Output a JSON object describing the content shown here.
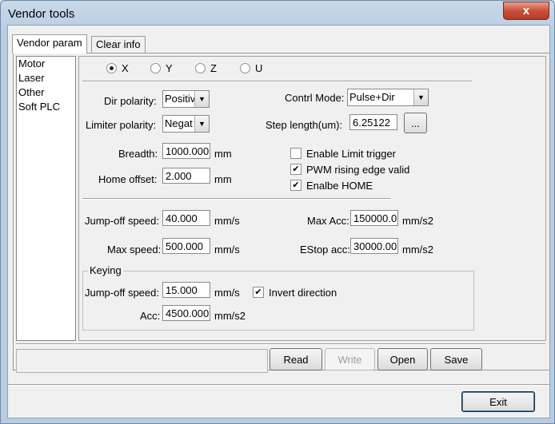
{
  "window": {
    "title": "Vendor tools",
    "close_glyph": "x"
  },
  "tabs": [
    {
      "label": "Vendor param"
    },
    {
      "label": "Clear info"
    }
  ],
  "sidebar": {
    "items": [
      "Motor",
      "Laser",
      "Other",
      "Soft PLC"
    ]
  },
  "axes": {
    "options": [
      "X",
      "Y",
      "Z",
      "U"
    ],
    "selected": "X"
  },
  "motor": {
    "dir_polarity_label": "Dir polarity:",
    "dir_polarity_value": "Positiv",
    "limiter_polarity_label": "Limiter polarity:",
    "limiter_polarity_value": "Negat",
    "control_mode_label": "Contrl Mode:",
    "control_mode_value": "Pulse+Dir",
    "step_length_label": "Step length(um):",
    "step_length_value": "6.25122",
    "step_length_browse": "...",
    "breadth_label": "Breadth:",
    "breadth_value": "1000.000",
    "breadth_unit": "mm",
    "home_offset_label": "Home offset:",
    "home_offset_value": "2.000",
    "home_offset_unit": "mm",
    "enable_limit_trigger_label": "Enable Limit trigger",
    "enable_limit_trigger_checked": false,
    "pwm_rising_label": "PWM rising edge valid",
    "pwm_rising_checked": true,
    "enable_home_label": "Enalbe HOME",
    "enable_home_checked": true,
    "jumpoff_speed_label": "Jump-off speed:",
    "jumpoff_speed_value": "40.000",
    "jumpoff_speed_unit": "mm/s",
    "max_acc_label": "Max Acc:",
    "max_acc_value": "150000.0",
    "max_acc_unit": "mm/s2",
    "max_speed_label": "Max speed:",
    "max_speed_value": "500.000",
    "max_speed_unit": "mm/s",
    "estop_acc_label": "EStop acc:",
    "estop_acc_value": "30000.00",
    "estop_acc_unit": "mm/s2"
  },
  "keying": {
    "group_label": "Keying",
    "jumpoff_speed_label": "Jump-off speed:",
    "jumpoff_speed_value": "15.000",
    "jumpoff_speed_unit": "mm/s",
    "invert_direction_label": "Invert direction",
    "invert_direction_checked": true,
    "acc_label": "Acc:",
    "acc_value": "4500.000",
    "acc_unit": "mm/s2"
  },
  "buttons": {
    "read": "Read",
    "write": "Write",
    "open": "Open",
    "save": "Save",
    "exit": "Exit"
  },
  "glyphs": {
    "check": "✔",
    "dropdown": "▼"
  }
}
